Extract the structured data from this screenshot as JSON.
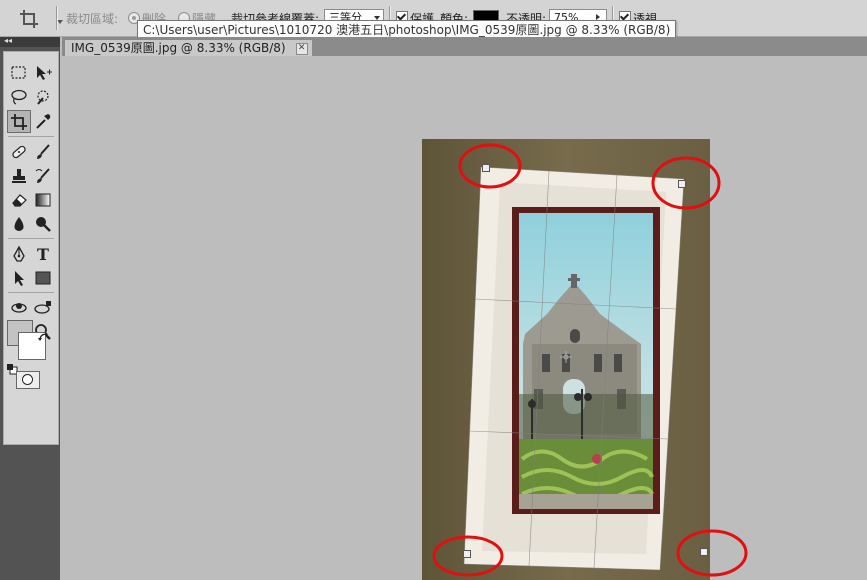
{
  "options_bar": {
    "crop_area_label": "裁切區域:",
    "radio_delete": "刪除",
    "radio_hide": "隱藏",
    "guide_overlay_label": "裁切參考線覆蓋:",
    "guide_overlay_value": "三等分",
    "shield_label": "保護",
    "color_label": "顏色:",
    "opacity_label": "不透明:",
    "opacity_value": "75%",
    "perspective_label": "透視",
    "shield_color": "#000000"
  },
  "tooltip": {
    "text": "C:\\Users\\user\\Pictures\\1010720 澳港五日\\photoshop\\IMG_0539原圖.jpg @ 8.33% (RGB/8)"
  },
  "toolbox": {
    "header": "◂◂",
    "selected_tool": "crop-tool",
    "foreground_color": "#c3c3c3",
    "background_color": "#ffffff"
  },
  "document": {
    "tab_title": "IMG_0539原圖.jpg @ 8.33% (RGB/8)",
    "close_glyph": "✕"
  },
  "annotations": {
    "circle_color": "#e01010"
  }
}
